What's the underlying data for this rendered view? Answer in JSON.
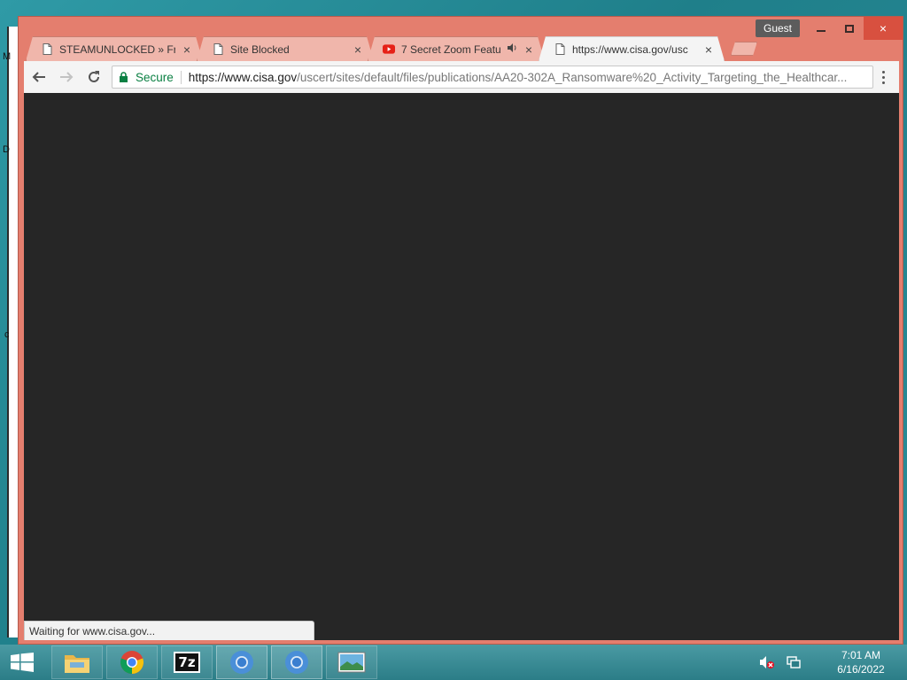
{
  "desktop": {
    "peek_letters": [
      "M",
      "D",
      "c"
    ]
  },
  "window": {
    "guest_label": "Guest",
    "tabs": [
      {
        "title": "STEAMUNLOCKED » Free",
        "icon": "page-icon",
        "active": false
      },
      {
        "title": "Site Blocked",
        "icon": "page-icon",
        "active": false
      },
      {
        "title": "7 Secret Zoom Featu",
        "icon": "youtube-icon",
        "active": false,
        "audio": true
      },
      {
        "title": "https://www.cisa.gov/usc",
        "icon": "page-icon",
        "active": true
      }
    ],
    "close_glyph": "×"
  },
  "toolbar": {
    "secure_label": "Secure",
    "url_host": "https://www.cisa.gov",
    "url_path": "/uscert/sites/default/files/publications/AA20-302A_Ransomware%20_Activity_Targeting_the_Healthcar..."
  },
  "content": {
    "status_text": "Waiting for www.cisa.gov..."
  },
  "taskbar": {
    "apps": [
      "file-explorer-icon",
      "chrome-icon",
      "7zip-icon",
      "chromium-icon",
      "chromium-icon",
      "photo-viewer-icon"
    ],
    "sevenzip_label": "7z",
    "clock_time": "7:01 AM",
    "clock_date": "6/16/2022"
  },
  "colors": {
    "window_frame": "#e47e6e",
    "tab_inactive": "#f0b6ab",
    "secure_green": "#0b8043",
    "content_bg": "#262626"
  }
}
